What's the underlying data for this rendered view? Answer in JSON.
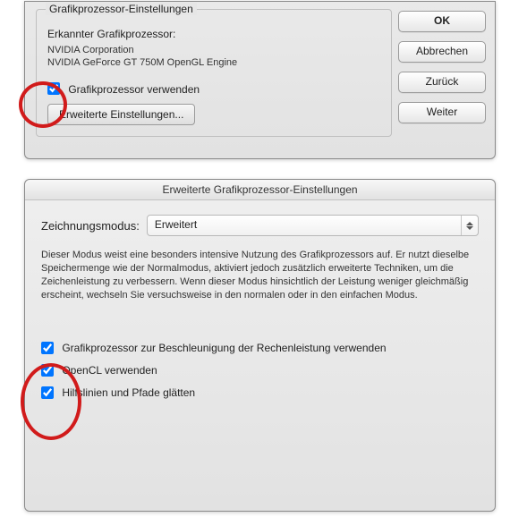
{
  "top": {
    "fieldset_legend": "Grafikprozessor-Einstellungen",
    "detected_label": "Erkannter Grafikprozessor:",
    "gpu_line1": "NVIDIA Corporation",
    "gpu_line2": "NVIDIA GeForce GT 750M OpenGL Engine",
    "use_gpu_label": "Grafikprozessor verwenden",
    "advanced_button": "Erweiterte Einstellungen...",
    "buttons": {
      "ok": "OK",
      "cancel": "Abbrechen",
      "back": "Zurück",
      "next": "Weiter"
    }
  },
  "bottom": {
    "title": "Erweiterte Grafikprozessor-Einstellungen",
    "mode_label": "Zeichnungsmodus:",
    "mode_value": "Erweitert",
    "description": "Dieser Modus weist eine besonders intensive Nutzung des Grafikprozessors auf. Er nutzt dieselbe Speichermenge wie der Normalmodus, aktiviert jedoch zusätzlich erweiterte Techniken, um die Zeichenleistung zu verbessern. Wenn dieser Modus hinsichtlich der Leistung weniger gleichmäßig erscheint, wechseln Sie versuchsweise in den normalen oder in den einfachen Modus.",
    "opt1": "Grafikprozessor zur Beschleunigung der Rechenleistung verwenden",
    "opt2": "OpenCL verwenden",
    "opt3": "Hilfslinien und Pfade glätten"
  }
}
